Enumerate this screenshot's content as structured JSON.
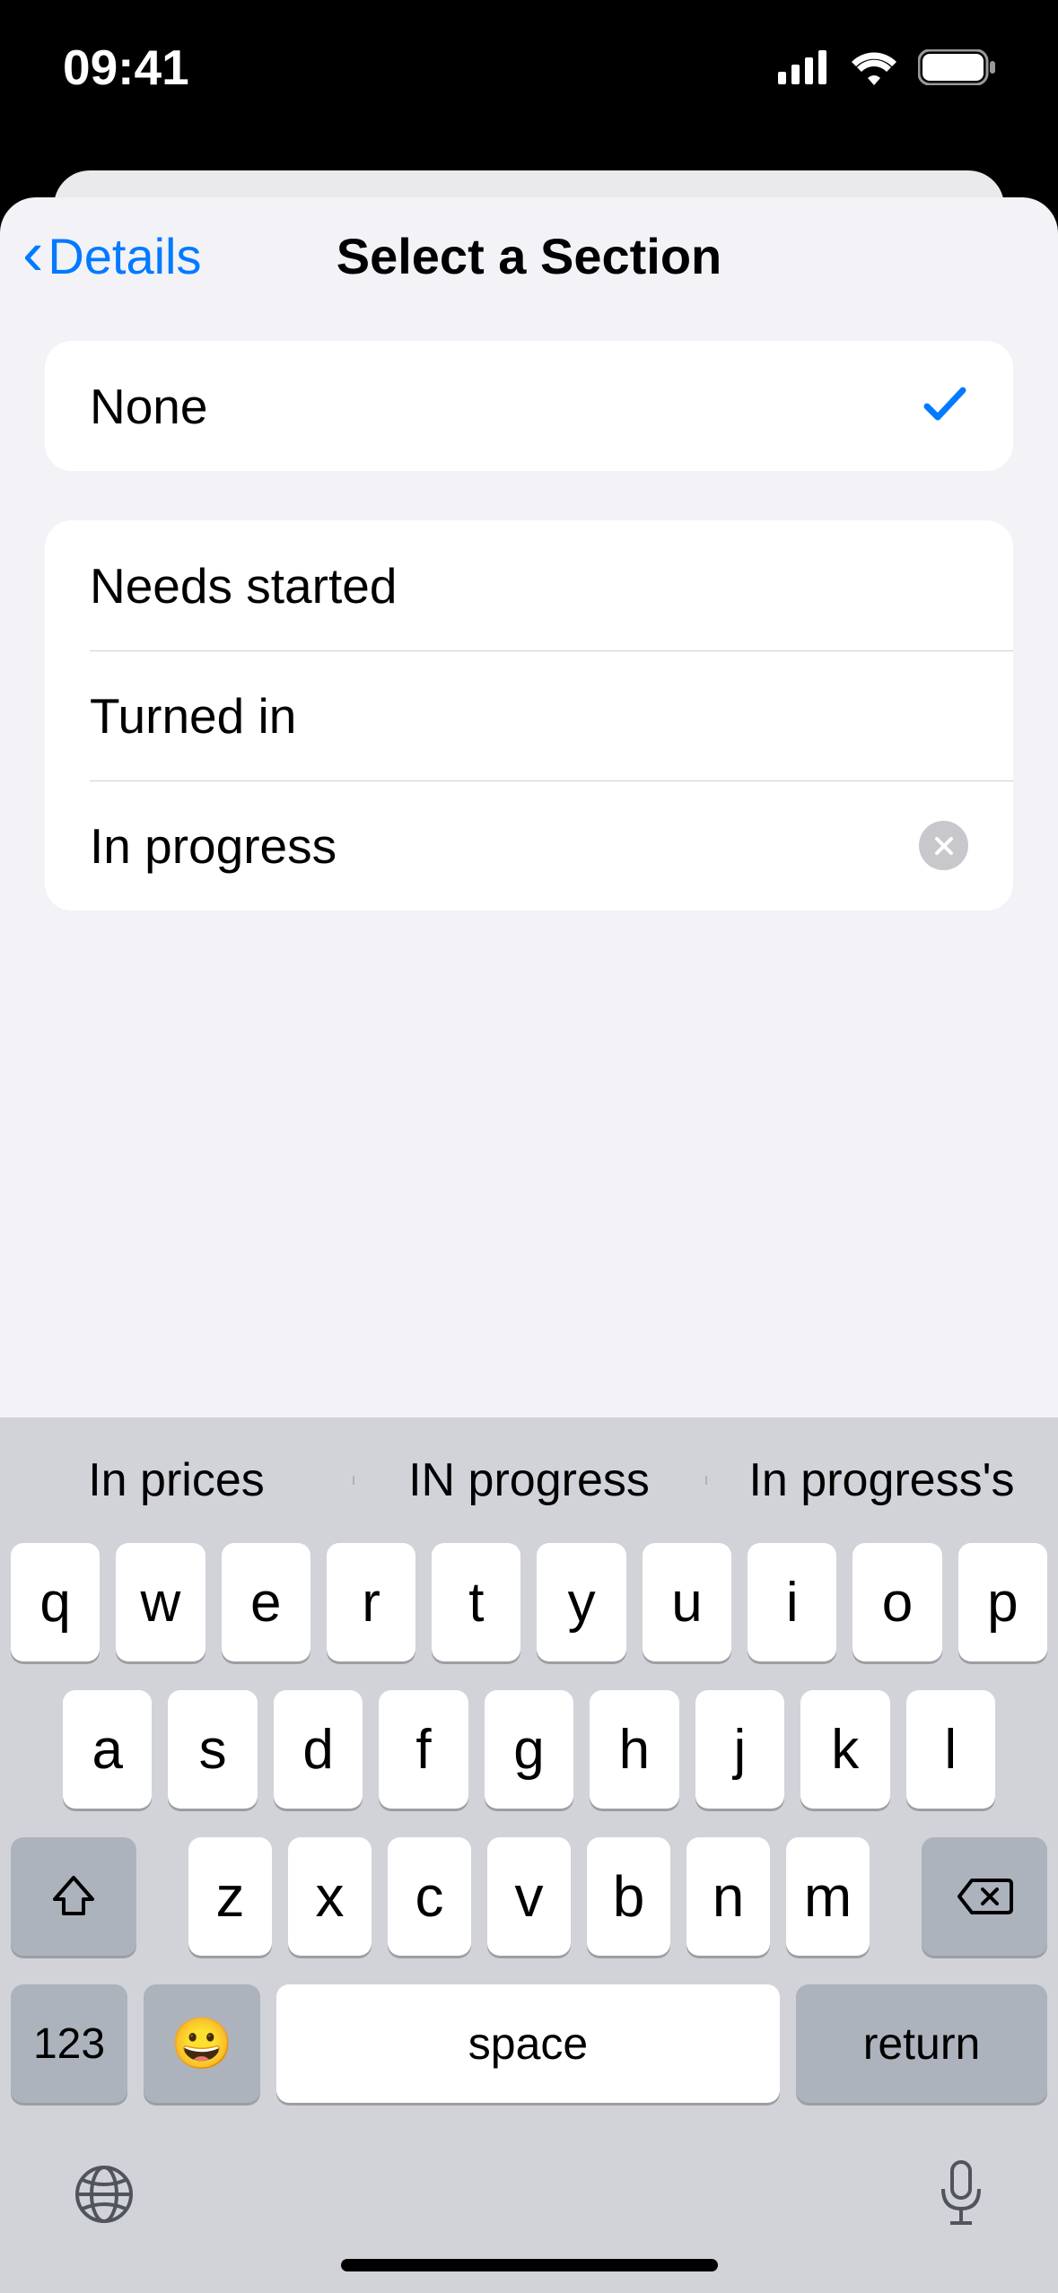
{
  "status": {
    "time": "09:41"
  },
  "nav": {
    "back_label": "Details",
    "title": "Select a Section"
  },
  "sections": {
    "none": "None",
    "items": [
      "Needs started",
      "Turned in"
    ],
    "editing": "In progress"
  },
  "keyboard": {
    "suggestions": [
      "In prices",
      "IN progress",
      "In progress's"
    ],
    "row1": [
      "q",
      "w",
      "e",
      "r",
      "t",
      "y",
      "u",
      "i",
      "o",
      "p"
    ],
    "row2": [
      "a",
      "s",
      "d",
      "f",
      "g",
      "h",
      "j",
      "k",
      "l"
    ],
    "row3": [
      "z",
      "x",
      "c",
      "v",
      "b",
      "n",
      "m"
    ],
    "num_key": "123",
    "space_key": "space",
    "return_key": "return"
  }
}
